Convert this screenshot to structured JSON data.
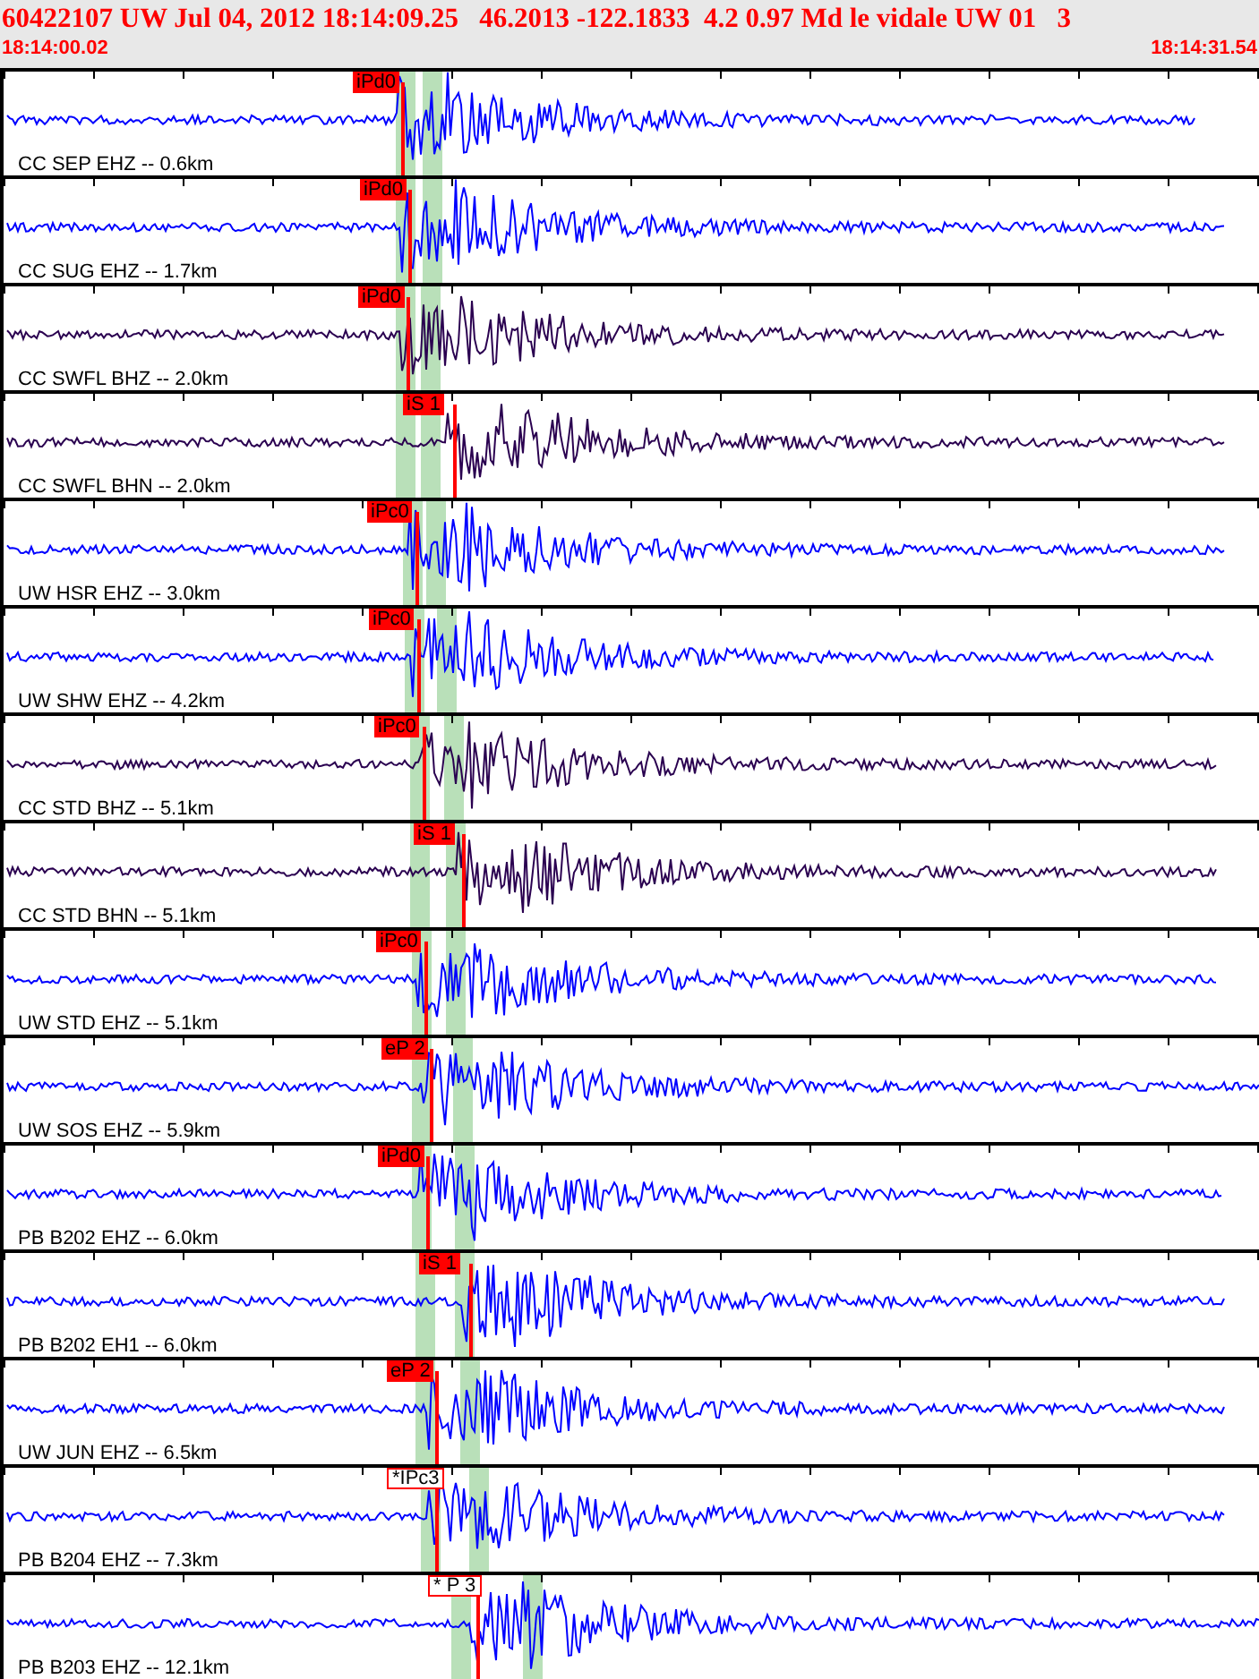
{
  "header": {
    "title": "60422107 UW Jul 04, 2012 18:14:09.25   46.2013 -122.1833  4.2 0.97 Md le vidale UW 01   3",
    "start_time": "18:14:00.02",
    "end_time": "18:14:31.54"
  },
  "traces": [
    {
      "label": "CC SEP EHZ -- 0.6km",
      "color": "#0000ff",
      "pick": {
        "label": "iPd0",
        "filled": true
      }
    },
    {
      "label": "CC SUG EHZ -- 1.7km",
      "color": "#0000ff",
      "pick": {
        "label": "iPd0",
        "filled": true
      }
    },
    {
      "label": "CC SWFL BHZ -- 2.0km",
      "color": "#2a0050",
      "pick": {
        "label": "iPd0",
        "filled": true
      }
    },
    {
      "label": "CC SWFL BHN -- 2.0km",
      "color": "#2a0050",
      "pick": {
        "label": "iS 1",
        "filled": true
      }
    },
    {
      "label": "UW HSR EHZ -- 3.0km",
      "color": "#0000ff",
      "pick": {
        "label": "iPc0",
        "filled": true
      }
    },
    {
      "label": "UW SHW EHZ -- 4.2km",
      "color": "#0000ff",
      "pick": {
        "label": "iPc0",
        "filled": true
      }
    },
    {
      "label": "CC STD BHZ -- 5.1km",
      "color": "#2a0050",
      "pick": {
        "label": "iPc0",
        "filled": true
      }
    },
    {
      "label": "CC STD BHN -- 5.1km",
      "color": "#2a0050",
      "pick": {
        "label": "iS 1",
        "filled": true
      }
    },
    {
      "label": "UW STD EHZ -- 5.1km",
      "color": "#0000ff",
      "pick": {
        "label": "iPc0",
        "filled": true
      }
    },
    {
      "label": "UW SOS EHZ -- 5.9km",
      "color": "#0000ff",
      "pick": {
        "label": "eP 2",
        "filled": true
      }
    },
    {
      "label": "PB B202 EHZ -- 6.0km",
      "color": "#0000ff",
      "pick": {
        "label": "iPd0",
        "filled": true
      }
    },
    {
      "label": "PB B202 EH1 -- 6.0km",
      "color": "#0000ff",
      "pick": {
        "label": "iS 1",
        "filled": true
      }
    },
    {
      "label": "UW JUN EHZ -- 6.5km",
      "color": "#0000ff",
      "pick": {
        "label": "eP 2",
        "filled": true
      }
    },
    {
      "label": "PB B204 EHZ -- 7.3km",
      "color": "#0000ff",
      "pick": {
        "label": "*IPc3",
        "filled": false
      }
    },
    {
      "label": "PB B203 EHZ -- 12.1km",
      "color": "#0000ff",
      "pick": {
        "label": "* P 3",
        "filled": false
      }
    }
  ]
}
